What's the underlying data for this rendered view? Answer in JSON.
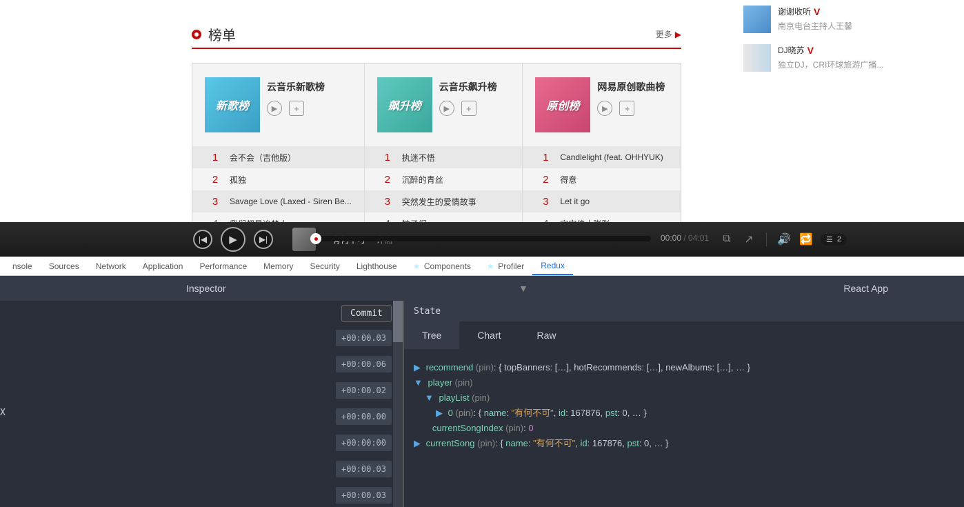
{
  "section": {
    "title": "榜单",
    "more": "更多"
  },
  "ranks": [
    {
      "title": "云音乐新歌榜",
      "coverText": "新歌榜",
      "coverClass": "cover-new",
      "items": [
        "会不会（吉他版）",
        "孤独",
        "Savage Love (Laxed - Siren Be...",
        "我们都是追梦人"
      ]
    },
    {
      "title": "云音乐飙升榜",
      "coverText": "飙升榜",
      "coverClass": "cover-rise",
      "items": [
        "执迷不悟",
        "沉醉的青丝",
        "突然发生的爱情故事",
        "粒子们"
      ]
    },
    {
      "title": "网易原创歌曲榜",
      "coverText": "原创榜",
      "coverClass": "cover-orig",
      "items": [
        "Candlelight (feat. OHHYUK)",
        "得意",
        "Let it go",
        "宇宙停止膨胀"
      ]
    }
  ],
  "djs": [
    {
      "name": "谢谢收听",
      "desc": "南京电台主持人王馨"
    },
    {
      "name": "DJ晓苏",
      "desc": "独立DJ，CRI环球旅游广播..."
    }
  ],
  "player": {
    "song": "有何不可",
    "artist": "许嵩",
    "current": "00:00",
    "total": "04:01",
    "queueCount": "2"
  },
  "devtools": {
    "tabs": [
      "nsole",
      "Sources",
      "Network",
      "Application",
      "Performance",
      "Memory",
      "Security",
      "Lighthouse",
      "Components",
      "Profiler",
      "Redux"
    ],
    "inspector": "Inspector",
    "reactApp": "React App",
    "commit": "Commit",
    "times": [
      "+00:00.03",
      "+00:00.06",
      "+00:00.02",
      "+00:00.00",
      "+00:00:00",
      "+00:00.03",
      "+00:00.03"
    ],
    "ex": "X",
    "stateLabel": "State",
    "stateTabs": [
      "Tree",
      "Chart",
      "Raw"
    ],
    "tree": {
      "recommend": "recommend",
      "recommend_body": "{ topBanners: […], hotRecommends: […], newAlbums: […], … }",
      "player": "player",
      "playList": "playList",
      "zero": "0",
      "zero_body": "{ name: \"有何不可\", id: 167876, pst: 0, … }",
      "csi": "currentSongIndex",
      "csi_val": "0",
      "cs": "currentSong",
      "cs_body": "{ name: \"有何不可\", id: 167876, pst: 0, … }",
      "pin": "(pin)"
    }
  }
}
